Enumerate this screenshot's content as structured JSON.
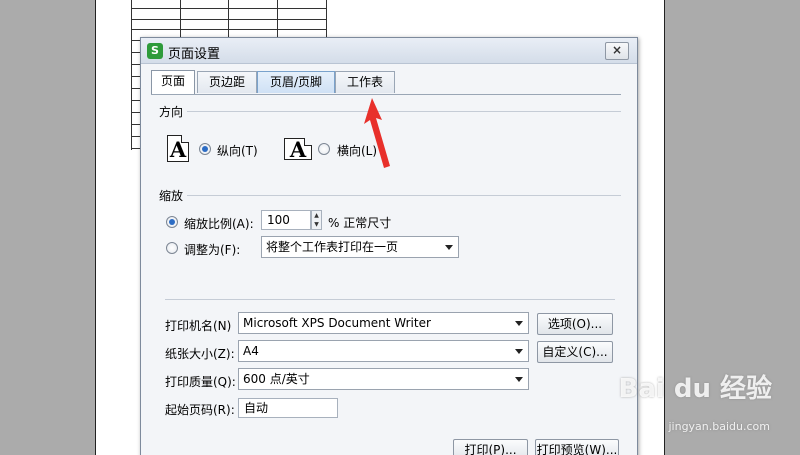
{
  "dialog": {
    "title": "页面设置",
    "app_icon": "S",
    "close": "×"
  },
  "tabs": [
    {
      "label": "页面",
      "active": true
    },
    {
      "label": "页边距",
      "active": false
    },
    {
      "label": "页眉/页脚",
      "active": false
    },
    {
      "label": "工作表",
      "active": false
    }
  ],
  "orientation": {
    "heading": "方向",
    "icon_glyph": "A",
    "portrait_label": "纵向(T)",
    "landscape_label": "横向(L)",
    "selected": "portrait"
  },
  "scaling": {
    "heading": "缩放",
    "scale_label": "缩放比例(A):",
    "scale_value": "100",
    "scale_suffix": "% 正常尺寸",
    "fit_label": "调整为(F):",
    "fit_option": "将整个工作表打印在一页",
    "selected": "scale"
  },
  "printer": {
    "name_label": "打印机名(N)",
    "name_value": "Microsoft XPS Document Writer",
    "options_button": "选项(O)...",
    "paper_label": "纸张大小(Z):",
    "paper_value": "A4",
    "custom_button": "自定义(C)...",
    "quality_label": "打印质量(Q):",
    "quality_value": "600 点/英寸",
    "start_page_label": "起始页码(R):",
    "start_page_value": "自动"
  },
  "buttons": {
    "print": "打印(P)...",
    "print_preview": "打印预览(W)..."
  },
  "annotation": {
    "color": "#e8302b"
  },
  "watermark": {
    "text": "Bai du 经验",
    "url": "jingyan.baidu.com"
  }
}
